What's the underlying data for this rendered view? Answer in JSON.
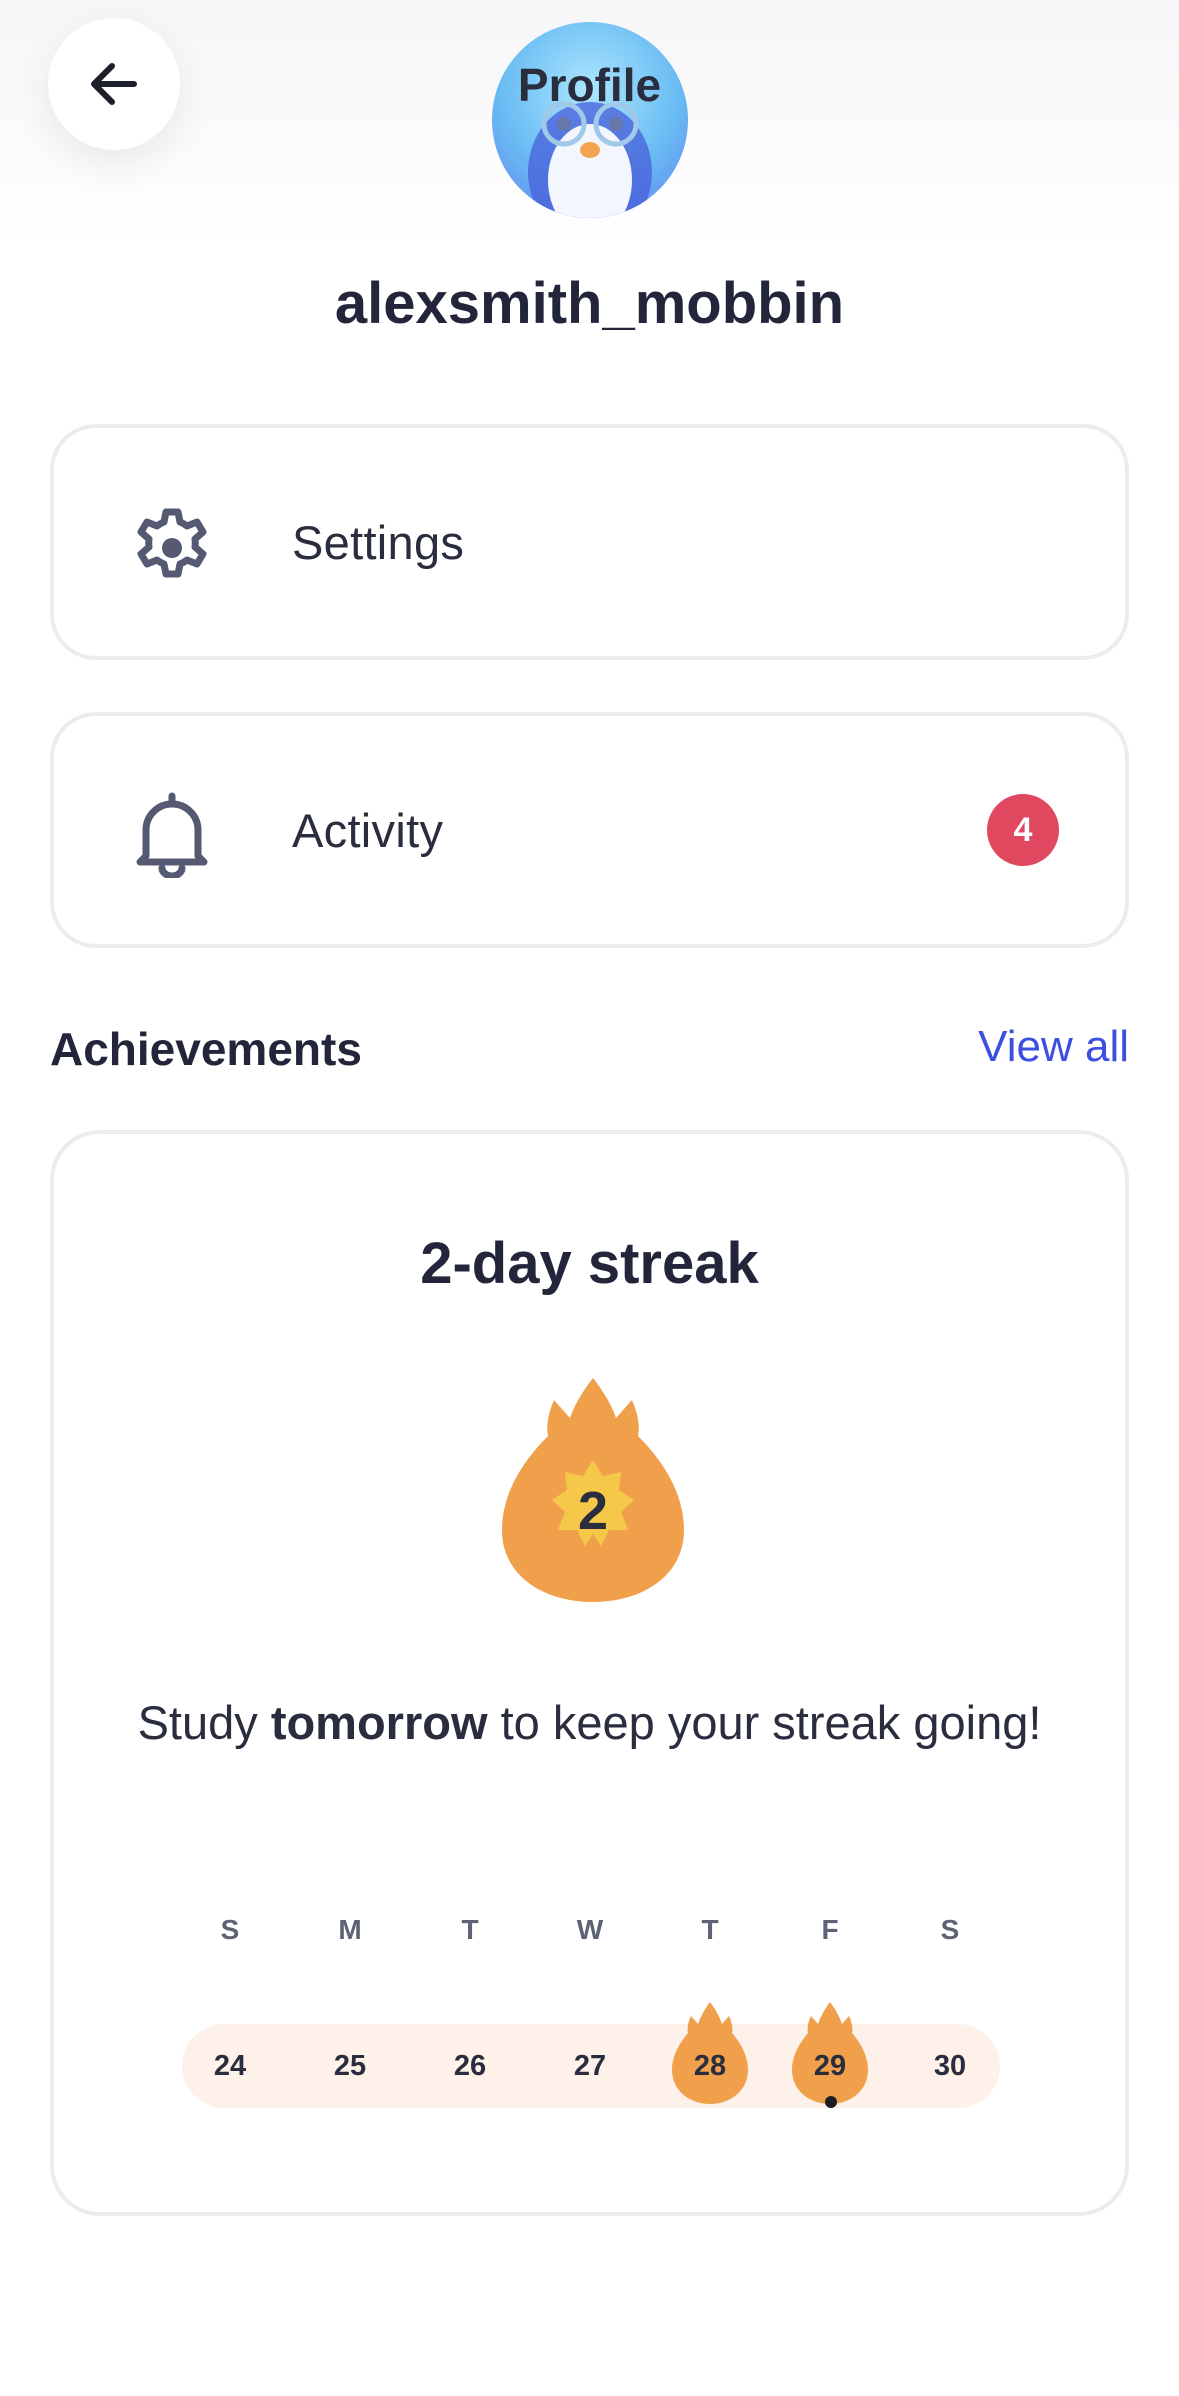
{
  "header": {
    "title": "Profile",
    "back_icon": "arrow-left-icon"
  },
  "profile": {
    "username": "alexsmith_mobbin",
    "avatar": "penguin-avatar"
  },
  "menu": {
    "settings": {
      "label": "Settings",
      "icon": "gear-icon"
    },
    "activity": {
      "label": "Activity",
      "icon": "bell-icon",
      "badge": "4"
    }
  },
  "achievements": {
    "title": "Achievements",
    "view_all": "View all"
  },
  "streak": {
    "title": "2-day streak",
    "count": "2",
    "message_pre": "Study ",
    "message_bold": "tomorrow",
    "message_post": " to keep your streak going!",
    "weekdays": [
      "S",
      "M",
      "T",
      "W",
      "T",
      "F",
      "S"
    ],
    "days": [
      "24",
      "25",
      "26",
      "27",
      "28",
      "29",
      "30"
    ],
    "active_days": [
      "28",
      "29"
    ],
    "today": "29"
  },
  "colors": {
    "accent": "#3c4fe0",
    "badge": "#e0485f",
    "flame": "#f0a04b",
    "flame_inner": "#f5c84a",
    "streak_bar": "#fdf1ea"
  }
}
